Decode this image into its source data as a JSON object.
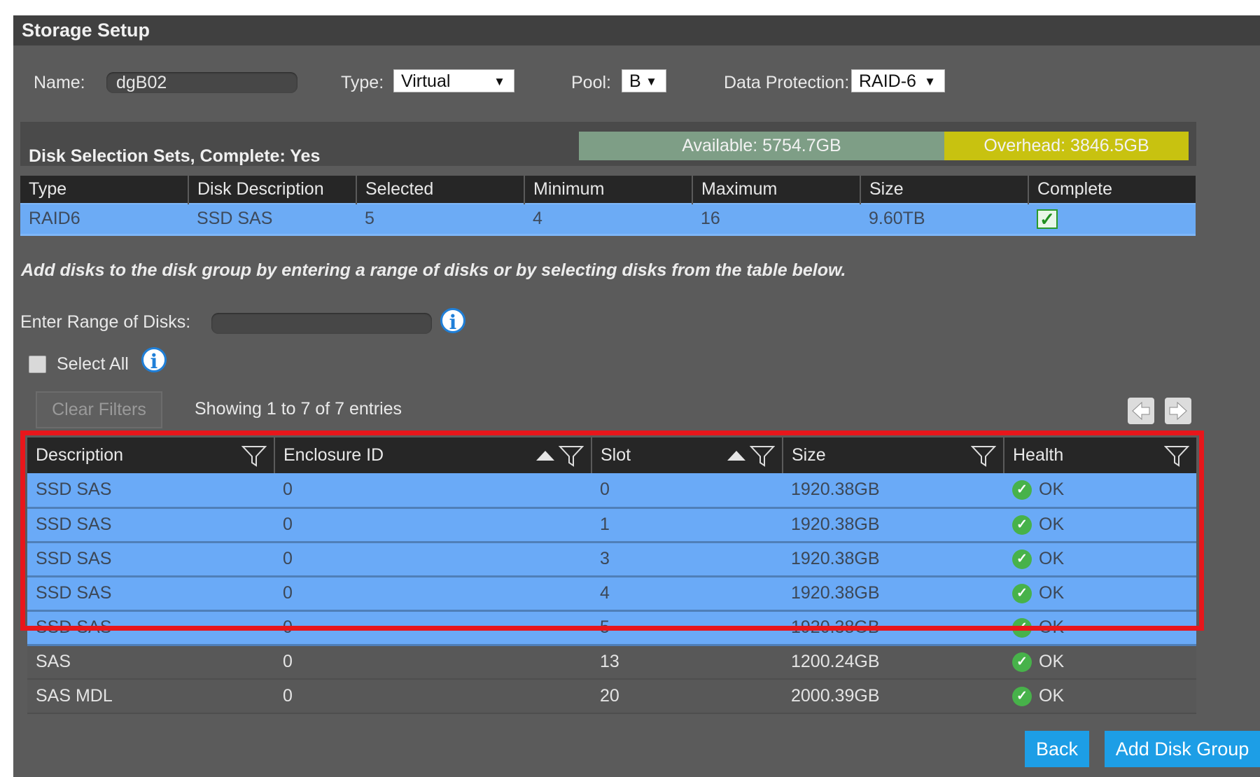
{
  "window": {
    "title": "Storage Setup"
  },
  "form": {
    "name_label": "Name:",
    "name_value": "dgB02",
    "type_label": "Type:",
    "type_value": "Virtual",
    "pool_label": "Pool:",
    "pool_value": "B",
    "protection_label": "Data Protection:",
    "protection_value": "RAID-6"
  },
  "disk_sets": {
    "title": "Disk Selection Sets, Complete: Yes",
    "available": "Available: 5754.7GB",
    "overhead": "Overhead: 3846.5GB",
    "columns": [
      "Type",
      "Disk Description",
      "Selected",
      "Minimum",
      "Maximum",
      "Size",
      "Complete"
    ],
    "rows": [
      {
        "type": "RAID6",
        "description": "SSD SAS",
        "selected": "5",
        "minimum": "4",
        "maximum": "16",
        "size": "9.60TB",
        "complete": true
      }
    ]
  },
  "instructions": "Add disks to the disk group by entering a range of disks or by selecting disks from the table below.",
  "range": {
    "label": "Enter Range of Disks:",
    "value": ""
  },
  "select_all": {
    "label": "Select All",
    "checked": false
  },
  "filters": {
    "clear_label": "Clear Filters",
    "showing": "Showing 1 to 7 of 7 entries"
  },
  "disk_table": {
    "columns": [
      "Description",
      "Enclosure ID",
      "Slot",
      "Size",
      "Health"
    ],
    "rows": [
      {
        "description": "SSD SAS",
        "enclosure": "0",
        "slot": "0",
        "size": "1920.38GB",
        "health": "OK",
        "selected": true
      },
      {
        "description": "SSD SAS",
        "enclosure": "0",
        "slot": "1",
        "size": "1920.38GB",
        "health": "OK",
        "selected": true
      },
      {
        "description": "SSD SAS",
        "enclosure": "0",
        "slot": "3",
        "size": "1920.38GB",
        "health": "OK",
        "selected": true
      },
      {
        "description": "SSD SAS",
        "enclosure": "0",
        "slot": "4",
        "size": "1920.38GB",
        "health": "OK",
        "selected": true
      },
      {
        "description": "SSD SAS",
        "enclosure": "0",
        "slot": "5",
        "size": "1920.38GB",
        "health": "OK",
        "selected": true
      },
      {
        "description": "SAS",
        "enclosure": "0",
        "slot": "13",
        "size": "1200.24GB",
        "health": "OK",
        "selected": false
      },
      {
        "description": "SAS MDL",
        "enclosure": "0",
        "slot": "20",
        "size": "2000.39GB",
        "health": "OK",
        "selected": false
      }
    ]
  },
  "buttons": {
    "back": "Back",
    "add": "Add Disk Group"
  },
  "colors": {
    "panel": "#5b5b5b",
    "header": "#262626",
    "selected_row": "#6aaaf7",
    "available": "#7e9e86",
    "overhead": "#c8c210",
    "highlight": "#e8161b",
    "button": "#1d9ee6"
  },
  "icons": {
    "info": "info-icon",
    "filter": "filter-funnel-icon",
    "sort": "sort-ascending-icon",
    "health_ok": "check-circle-icon",
    "pager_prev": "arrow-left-icon",
    "pager_next": "arrow-right-icon",
    "dropdown": "dropdown-arrow-icon"
  }
}
